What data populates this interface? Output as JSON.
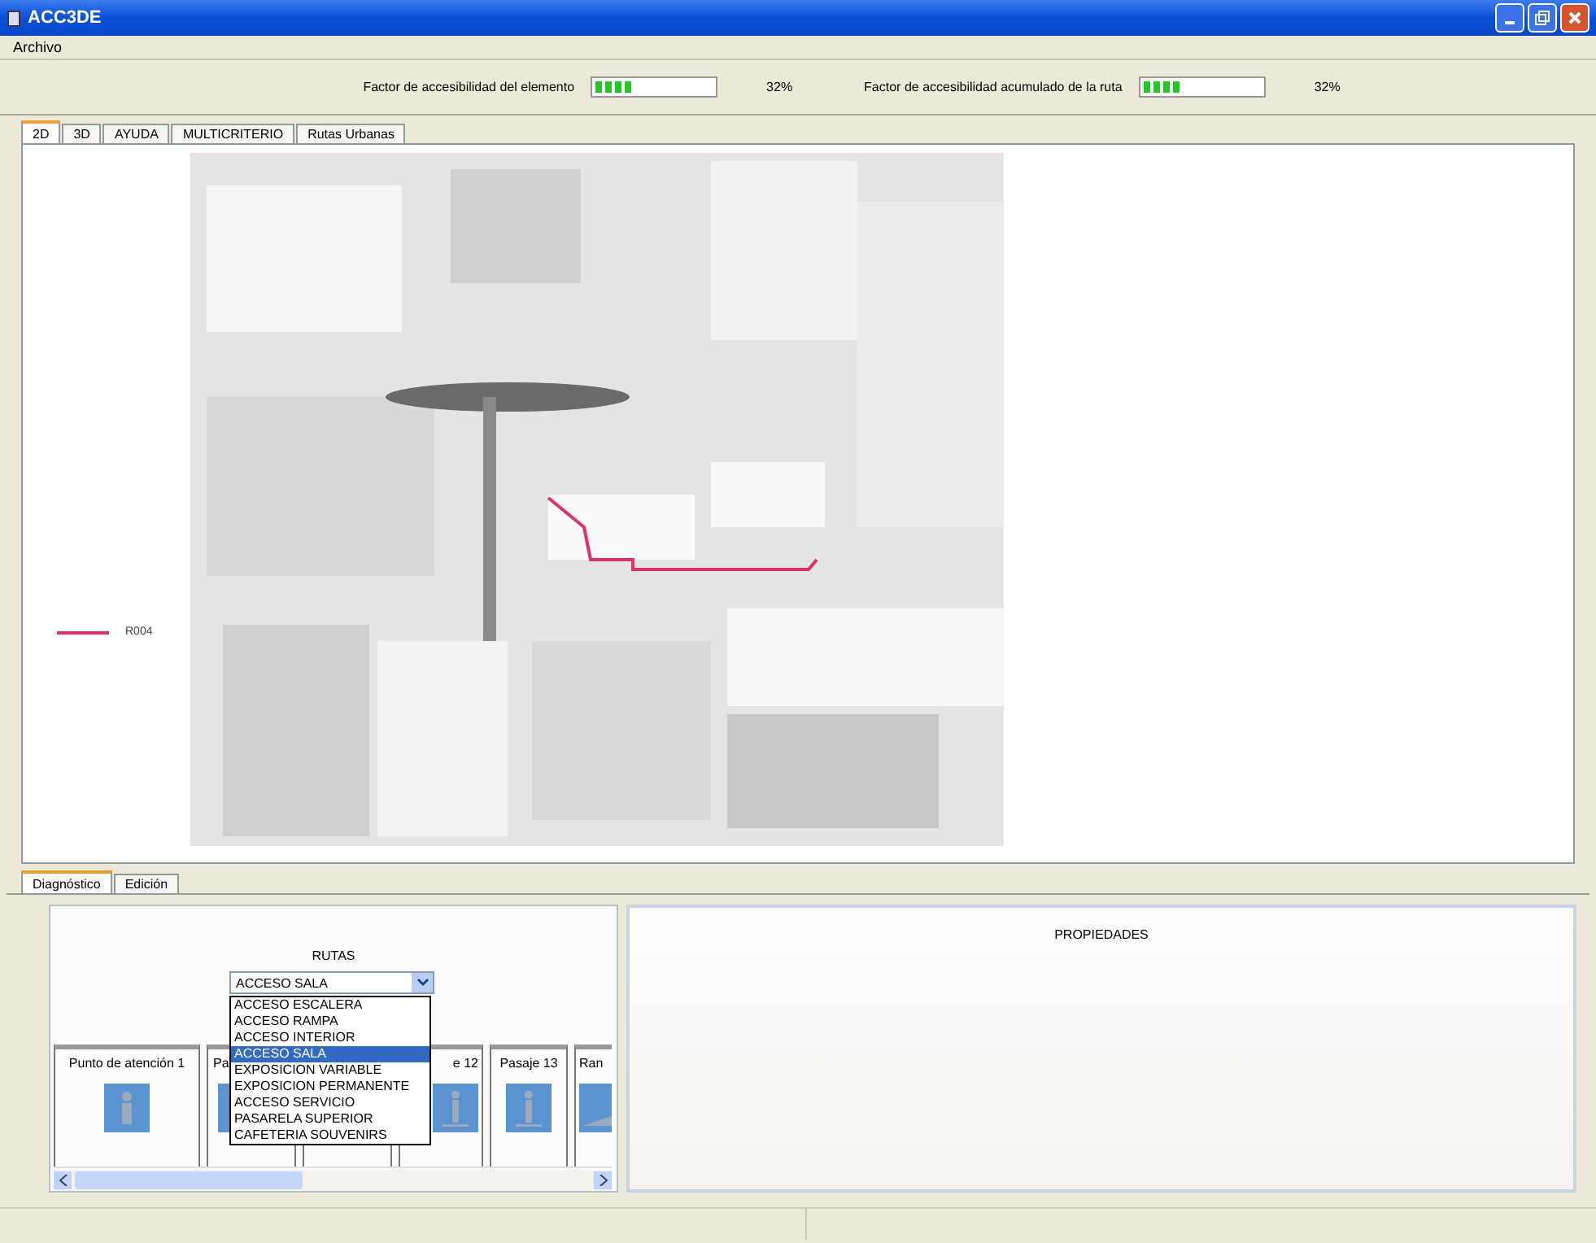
{
  "window": {
    "title": "ACC3DE"
  },
  "menu": [
    "Archivo"
  ],
  "meters": [
    {
      "label": "Factor de accesibilidad del elemento",
      "level": 0.32,
      "reading": "32%"
    },
    {
      "label": "Factor de accesibilidad acumulado de la ruta",
      "level": 0.32,
      "reading": "32%"
    }
  ],
  "tabs": [
    {
      "label": "2D",
      "selected": true
    },
    {
      "label": "3D",
      "selected": false
    },
    {
      "label": "AYUDA",
      "selected": false
    },
    {
      "label": "MULTICRITERIO",
      "selected": false
    },
    {
      "label": "Rutas Urbanas",
      "selected": false
    }
  ],
  "map": {
    "kind": "picture",
    "legend": [
      {
        "label": "R004",
        "color": "#e0306a"
      }
    ]
  },
  "bottom_tabs": [
    {
      "label": "Diagnóstico",
      "selected": true
    },
    {
      "label": "Edición",
      "selected": false
    }
  ],
  "rutas": {
    "title": "RUTAS",
    "value": "ACCESO SALA",
    "options": [
      {
        "label": "ACCESO ESCALERA",
        "selected": false
      },
      {
        "label": "ACCESO RAMPA",
        "selected": false
      },
      {
        "label": "ACCESO INTERIOR",
        "selected": false
      },
      {
        "label": "ACCESO SALA",
        "selected": true
      },
      {
        "label": "EXPOSICION VARIABLE",
        "selected": false
      },
      {
        "label": "EXPOSICION PERMANENTE",
        "selected": false
      },
      {
        "label": "ACCESO SERVICIO",
        "selected": false
      },
      {
        "label": "PASARELA SUPERIOR",
        "selected": false
      },
      {
        "label": "CAFETERIA SOUVENIRS",
        "selected": false
      }
    ]
  },
  "cards": [
    {
      "label": "Punto de atención 1",
      "kind": "info"
    },
    {
      "label": "Pa",
      "kind": "sliver"
    },
    {
      "kind": "hidden"
    },
    {
      "label": "e 12",
      "kind": "person"
    },
    {
      "label": "Pasaje 13",
      "kind": "person"
    },
    {
      "label": "Ran",
      "kind": "ramp"
    }
  ],
  "properties": {
    "title": "PROPIEDADES"
  }
}
